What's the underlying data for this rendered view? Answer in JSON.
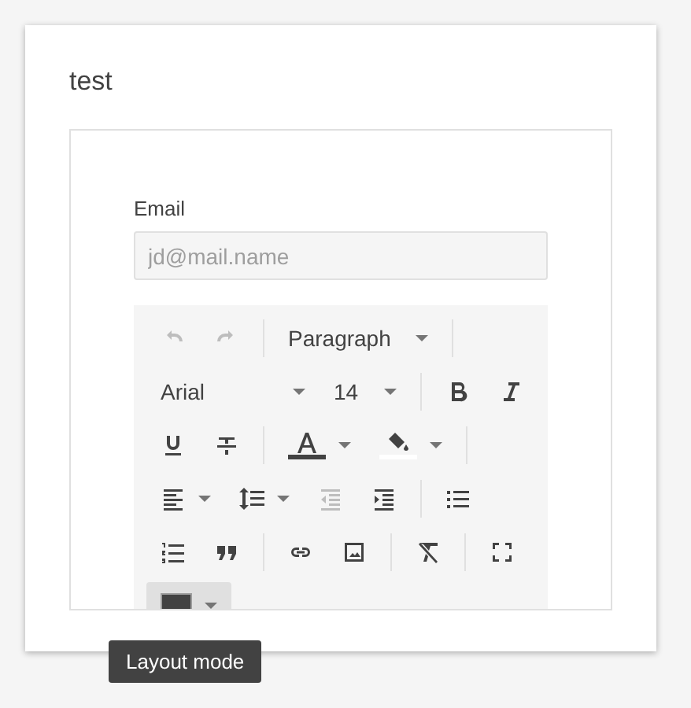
{
  "card": {
    "title": "test"
  },
  "form": {
    "email_label": "Email",
    "email_placeholder": "jd@mail.name"
  },
  "toolbar": {
    "rows": [
      [
        {
          "kind": "undo",
          "disabled": true
        },
        {
          "kind": "redo",
          "disabled": true
        },
        {
          "kind": "divider"
        },
        {
          "kind": "select",
          "label": "Paragraph"
        },
        {
          "kind": "divider"
        }
      ],
      [
        {
          "kind": "select",
          "label": "Arial",
          "wide": true
        },
        {
          "kind": "select",
          "label": "14"
        },
        {
          "kind": "divider"
        },
        {
          "kind": "bold",
          "disabled": false
        },
        {
          "kind": "italic",
          "disabled": false
        }
      ],
      [
        {
          "kind": "underline",
          "disabled": false
        },
        {
          "kind": "strike",
          "disabled": false
        },
        {
          "kind": "divider"
        },
        {
          "kind": "textcolor",
          "color": "#424242"
        },
        {
          "kind": "fillcolor",
          "color": "#ffffff"
        },
        {
          "kind": "divider"
        }
      ],
      [
        {
          "kind": "align",
          "caret": true,
          "disabled": false
        },
        {
          "kind": "lineheight",
          "caret": true,
          "disabled": false
        },
        {
          "kind": "outdent",
          "disabled": true
        },
        {
          "kind": "indent",
          "disabled": false
        },
        {
          "kind": "divider"
        },
        {
          "kind": "bullets",
          "disabled": false
        }
      ],
      [
        {
          "kind": "numbers",
          "disabled": false
        },
        {
          "kind": "quote",
          "disabled": false
        },
        {
          "kind": "divider"
        },
        {
          "kind": "link",
          "disabled": false
        },
        {
          "kind": "image",
          "disabled": false
        },
        {
          "kind": "divider"
        },
        {
          "kind": "clear",
          "disabled": false
        },
        {
          "kind": "divider"
        },
        {
          "kind": "fullscreen",
          "disabled": false
        }
      ],
      [
        {
          "kind": "swatch",
          "color": "#424242",
          "active": true
        }
      ]
    ]
  },
  "tooltip": {
    "text": "Layout mode"
  }
}
